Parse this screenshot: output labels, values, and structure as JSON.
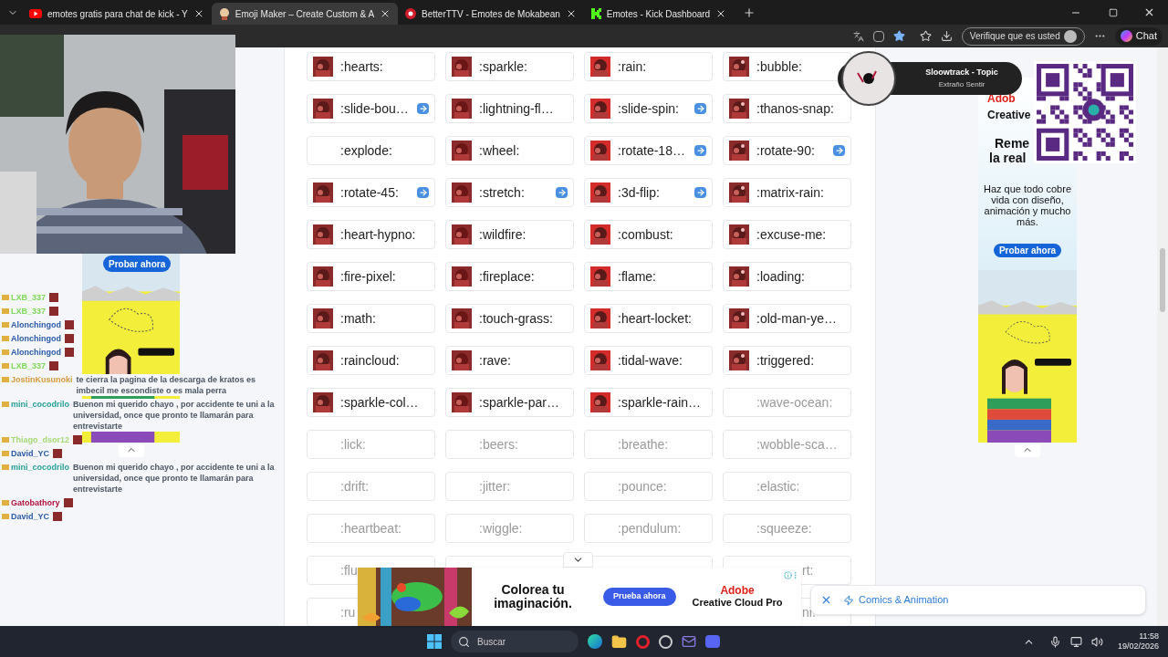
{
  "browser": {
    "tabs": [
      {
        "kind": "play",
        "title": "emotes gratis para chat de kick - Y",
        "selected": false
      },
      {
        "kind": "emoji",
        "title": "Emoji Maker – Create Custom & A",
        "selected": true
      },
      {
        "kind": "disc",
        "title": "BetterTTV - Emotes de Mokabean",
        "selected": false
      },
      {
        "kind": "kick",
        "title": "Emotes - Kick Dashboard",
        "selected": false
      }
    ],
    "verify_button": "Verifique que es usted",
    "chat_button": "Chat"
  },
  "chat": [
    {
      "user": "LXB_337",
      "color": "#7ed957",
      "kind": "emote"
    },
    {
      "user": "LXB_337",
      "color": "#7ed957",
      "kind": "emote"
    },
    {
      "user": "Alonchingod",
      "color": "#2b5ba8",
      "kind": "emote"
    },
    {
      "user": "Alonchingod",
      "color": "#2b5ba8",
      "kind": "emote"
    },
    {
      "user": "Alonchingod",
      "color": "#2b5ba8",
      "kind": "emote"
    },
    {
      "user": "LXB_337",
      "color": "#7ed957",
      "kind": "emote"
    },
    {
      "user": "JostinKusunoki",
      "color": "#d89a3c",
      "kind": "text",
      "text": "te cierra la pagina de la descarga de kratos es imbecil me escondiste o es mala perra"
    },
    {
      "user": "mini_cocodrilo",
      "color": "#2aa198",
      "kind": "text",
      "text": "Buenon mi querido chayo , por accidente te uni a la universidad, once que pronto te llamarán para entrevistarte"
    },
    {
      "user": "Thiago_dsor12",
      "color": "#a8d878",
      "kind": "emote"
    },
    {
      "user": "David_YC",
      "color": "#2b5ba8",
      "kind": "emote"
    },
    {
      "user": "mini_cocodrilo",
      "color": "#2aa198",
      "kind": "text",
      "text": "Buenon mi querido chayo , por accidente te uni a la universidad, once que pronto te llamarán para entrevistarte"
    },
    {
      "user": "Gatobathory",
      "color": "#b0103a",
      "kind": "emote"
    },
    {
      "user": "David_YC",
      "color": "#2b5ba8",
      "kind": "emote"
    }
  ],
  "left_ad": {
    "button": "Probar ahora"
  },
  "emotes": [
    {
      "kind": "emote",
      "name": ":hearts:",
      "thumb": true,
      "arrow": false,
      "dim": false
    },
    {
      "kind": "emote",
      "name": ":sparkle:",
      "thumb": true,
      "arrow": false,
      "dim": false
    },
    {
      "kind": "emote",
      "name": ":rain:",
      "thumb": true,
      "arrow": false,
      "dim": false
    },
    {
      "kind": "emote",
      "name": ":bubble:",
      "thumb": true,
      "arrow": false,
      "dim": false
    },
    {
      "kind": "emote",
      "name": ":slide-bou…",
      "thumb": true,
      "arrow": true,
      "dim": false
    },
    {
      "kind": "emote",
      "name": ":lightning-fl…",
      "thumb": true,
      "arrow": false,
      "dim": false
    },
    {
      "kind": "emote",
      "name": ":slide-spin:",
      "thumb": true,
      "arrow": true,
      "dim": false
    },
    {
      "kind": "emote",
      "name": ":thanos-snap:",
      "thumb": true,
      "arrow": false,
      "dim": false
    },
    {
      "kind": "emote",
      "name": ":explode:",
      "thumb": false,
      "arrow": false,
      "dim": false
    },
    {
      "kind": "emote",
      "name": ":wheel:",
      "thumb": true,
      "arrow": false,
      "dim": false
    },
    {
      "kind": "emote",
      "name": ":rotate-18…",
      "thumb": true,
      "arrow": true,
      "dim": false
    },
    {
      "kind": "emote",
      "name": ":rotate-90:",
      "thumb": true,
      "arrow": true,
      "dim": false
    },
    {
      "kind": "emote",
      "name": ":rotate-45:",
      "thumb": true,
      "arrow": true,
      "dim": false
    },
    {
      "kind": "emote",
      "name": ":stretch:",
      "thumb": true,
      "arrow": true,
      "dim": false
    },
    {
      "kind": "emote",
      "name": ":3d-flip:",
      "thumb": true,
      "arrow": true,
      "dim": false
    },
    {
      "kind": "emote",
      "name": ":matrix-rain:",
      "thumb": true,
      "arrow": false,
      "dim": false
    },
    {
      "kind": "emote",
      "name": ":heart-hypno:",
      "thumb": true,
      "arrow": false,
      "dim": false
    },
    {
      "kind": "emote",
      "name": ":wildfire:",
      "thumb": true,
      "arrow": false,
      "dim": false
    },
    {
      "kind": "emote",
      "name": ":combust:",
      "thumb": true,
      "arrow": false,
      "dim": false
    },
    {
      "kind": "emote",
      "name": ":excuse-me:",
      "thumb": true,
      "arrow": false,
      "dim": false
    },
    {
      "kind": "emote",
      "name": ":fire-pixel:",
      "thumb": true,
      "arrow": false,
      "dim": false
    },
    {
      "kind": "emote",
      "name": ":fireplace:",
      "thumb": true,
      "arrow": false,
      "dim": false
    },
    {
      "kind": "emote",
      "name": ":flame:",
      "thumb": true,
      "arrow": false,
      "dim": false
    },
    {
      "kind": "emote",
      "name": ":loading:",
      "thumb": true,
      "arrow": false,
      "dim": false
    },
    {
      "kind": "emote",
      "name": ":math:",
      "thumb": true,
      "arrow": false,
      "dim": false
    },
    {
      "kind": "emote",
      "name": ":touch-grass:",
      "thumb": true,
      "arrow": false,
      "dim": false
    },
    {
      "kind": "emote",
      "name": ":heart-locket:",
      "thumb": true,
      "arrow": false,
      "dim": false
    },
    {
      "kind": "emote",
      "name": ":old-man-ye…",
      "thumb": true,
      "arrow": false,
      "dim": false
    },
    {
      "kind": "emote",
      "name": ":raincloud:",
      "thumb": true,
      "arrow": false,
      "dim": false
    },
    {
      "kind": "emote",
      "name": ":rave:",
      "thumb": true,
      "arrow": false,
      "dim": false
    },
    {
      "kind": "emote",
      "name": ":tidal-wave:",
      "thumb": true,
      "arrow": false,
      "dim": false
    },
    {
      "kind": "emote",
      "name": ":triggered:",
      "thumb": true,
      "arrow": false,
      "dim": false
    },
    {
      "kind": "emote",
      "name": ":sparkle-col…",
      "thumb": true,
      "arrow": false,
      "dim": false
    },
    {
      "kind": "emote",
      "name": ":sparkle-par…",
      "thumb": true,
      "arrow": false,
      "dim": false
    },
    {
      "kind": "emote",
      "name": ":sparkle-rain…",
      "thumb": true,
      "arrow": false,
      "dim": false
    },
    {
      "kind": "emote",
      "name": ":wave-ocean:",
      "thumb": false,
      "arrow": false,
      "dim": true
    },
    {
      "kind": "emote",
      "name": ":lick:",
      "thumb": false,
      "arrow": false,
      "dim": true
    },
    {
      "kind": "emote",
      "name": ":beers:",
      "thumb": false,
      "arrow": false,
      "dim": true
    },
    {
      "kind": "emote",
      "name": ":breathe:",
      "thumb": false,
      "arrow": false,
      "dim": true
    },
    {
      "kind": "emote",
      "name": ":wobble-sca…",
      "thumb": false,
      "arrow": false,
      "dim": true
    },
    {
      "kind": "emote",
      "name": ":drift:",
      "thumb": false,
      "arrow": false,
      "dim": true
    },
    {
      "kind": "emote",
      "name": ":jitter:",
      "thumb": false,
      "arrow": false,
      "dim": true
    },
    {
      "kind": "emote",
      "name": ":pounce:",
      "thumb": false,
      "arrow": false,
      "dim": true
    },
    {
      "kind": "emote",
      "name": ":elastic:",
      "thumb": false,
      "arrow": false,
      "dim": true
    },
    {
      "kind": "emote",
      "name": ":heartbeat:",
      "thumb": false,
      "arrow": false,
      "dim": true
    },
    {
      "kind": "emote",
      "name": ":wiggle:",
      "thumb": false,
      "arrow": false,
      "dim": true
    },
    {
      "kind": "emote",
      "name": ":pendulum:",
      "thumb": false,
      "arrow": false,
      "dim": true
    },
    {
      "kind": "emote",
      "name": ":squeeze:",
      "thumb": false,
      "arrow": false,
      "dim": true
    },
    {
      "kind": "emote",
      "name": ":flu",
      "thumb": false,
      "arrow": false,
      "dim": true
    },
    {
      "kind": "covered"
    },
    {
      "kind": "covered"
    },
    {
      "kind": "tail",
      "name": "rt:",
      "dim": true
    },
    {
      "kind": "emote",
      "name": ":ru",
      "thumb": false,
      "arrow": false,
      "dim": true
    },
    {
      "kind": "tail",
      "name": "ni:",
      "dim": true
    }
  ],
  "music": {
    "title": "Sloowtrack - Topic",
    "subtitle": "Extraño Sentir"
  },
  "right_ad": {
    "brand": "Adob",
    "brand_line": "Creative",
    "headline_1": "Reme",
    "headline_2": "la real",
    "body": "Haz que todo cobre vida con diseño, animación y mucho más.",
    "button": "Probar ahora"
  },
  "bottom_ad": {
    "headline": "Colorea tu imaginación.",
    "button": "Prueba ahora",
    "brand": "Adobe",
    "product": "Creative Cloud Pro"
  },
  "topic_bar": {
    "label": "Comics & Animation"
  },
  "taskbar": {
    "search_placeholder": "Buscar",
    "time": "11:58",
    "date": "19/02/2026"
  }
}
